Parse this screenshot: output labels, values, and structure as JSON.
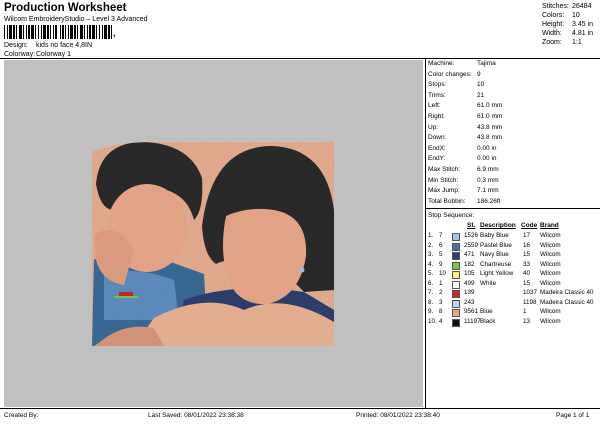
{
  "header": {
    "title": "Production Worksheet",
    "subtitle": "Wilcom EmbroideryStudio – Level 3 Advanced",
    "barcode_mark": ","
  },
  "design_info": {
    "design_label": "Design:",
    "design_value": "kids no face 4,8IN",
    "colorway_label": "Colorway:",
    "colorway_value": "Colorway 1"
  },
  "stats": [
    {
      "label": "Stitches:",
      "value": "26484"
    },
    {
      "label": "Colors:",
      "value": "10"
    },
    {
      "label": "Height:",
      "value": "3.45 in"
    },
    {
      "label": "Width:",
      "value": "4.81 in"
    },
    {
      "label": "Zoom:",
      "value": "1:1"
    }
  ],
  "machine_info": [
    {
      "label": "Machine:",
      "value": "Tajima"
    },
    {
      "label": "Color changes:",
      "value": "9"
    },
    {
      "label": "Stops:",
      "value": "10"
    },
    {
      "label": "Trims:",
      "value": "21"
    },
    {
      "label": "Left:",
      "value": "61.0 mm"
    },
    {
      "label": "Right:",
      "value": "61.0 mm"
    },
    {
      "label": "Up:",
      "value": "43.8 mm"
    },
    {
      "label": "Down:",
      "value": "43.8 mm"
    },
    {
      "label": "EndX:",
      "value": "0.00 in"
    },
    {
      "label": "EndY:",
      "value": "0.00 in"
    },
    {
      "label": "Max Stitch:",
      "value": "6.9 mm"
    },
    {
      "label": "Min Stitch:",
      "value": "0.3 mm"
    },
    {
      "label": "Max Jump:",
      "value": "7.1 mm"
    },
    {
      "label": "Total Bobbin:",
      "value": "186.26ft"
    }
  ],
  "stop_sequence": {
    "title": "Stop Sequence:",
    "headers": {
      "st": "St.",
      "description": "Description",
      "code": "Code",
      "brand": "Brand"
    },
    "rows": [
      {
        "n": "1.",
        "c": "7",
        "color": "#9fc4e6",
        "st": "1526",
        "desc": "Baby Blue",
        "code": "17",
        "brand": "Wilcom"
      },
      {
        "n": "2.",
        "c": "6",
        "color": "#4f6f9d",
        "st": "2559",
        "desc": "Pastel Blue",
        "code": "16",
        "brand": "Wilcom"
      },
      {
        "n": "3.",
        "c": "5",
        "color": "#2c3f73",
        "st": "471",
        "desc": "Navy Blue",
        "code": "15",
        "brand": "Wilcom"
      },
      {
        "n": "4.",
        "c": "9",
        "color": "#7ac943",
        "st": "182",
        "desc": "Chartreuse",
        "code": "33",
        "brand": "Wilcom"
      },
      {
        "n": "5.",
        "c": "10",
        "color": "#fff27a",
        "st": "105",
        "desc": "Light Yellow",
        "code": "40",
        "brand": "Wilcom"
      },
      {
        "n": "6.",
        "c": "1",
        "color": "#ffffff",
        "st": "499",
        "desc": "White",
        "code": "15",
        "brand": "Wilcom"
      },
      {
        "n": "7.",
        "c": "2",
        "color": "#cc2a2a",
        "st": "139",
        "desc": "",
        "code": "1037",
        "brand": "Madeira Classic 40"
      },
      {
        "n": "8.",
        "c": "3",
        "color": "#c6d3e6",
        "st": "243",
        "desc": "",
        "code": "1198",
        "brand": "Madeira Classic 40"
      },
      {
        "n": "9.",
        "c": "8",
        "color": "#e9a98a",
        "st": "9561",
        "desc": "Blue",
        "code": "1",
        "brand": "Wilcom"
      },
      {
        "n": "10.",
        "c": "4",
        "color": "#111111",
        "st": "11197",
        "desc": "Black",
        "code": "13",
        "brand": "Wilcom"
      }
    ]
  },
  "footer": {
    "created_by": "Created By:",
    "last_saved": "Last Saved: 08/01/2022 23:38:38",
    "printed": "Printed: 08/01/2022 23:38:40",
    "page": "Page 1 of 1"
  }
}
